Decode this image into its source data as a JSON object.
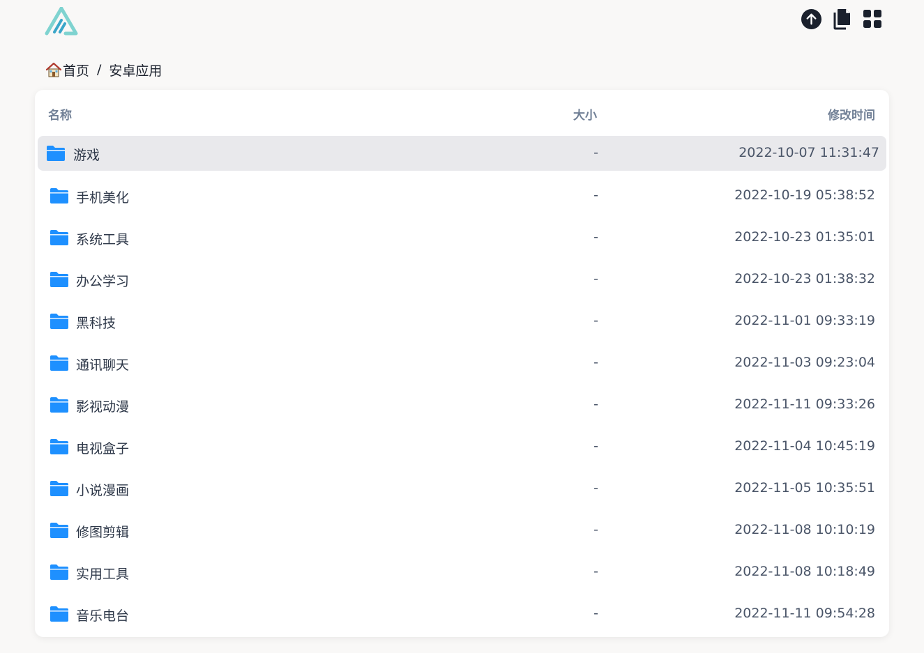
{
  "breadcrumb": {
    "home": "首页",
    "separator": "/",
    "current": "安卓应用"
  },
  "toolbar": {
    "icons": [
      "upload-icon",
      "copy-icon",
      "grid-icon"
    ]
  },
  "table": {
    "headers": {
      "name": "名称",
      "size": "大小",
      "time": "修改时间"
    },
    "rows": [
      {
        "name": "游戏",
        "size": "-",
        "time": "2022-10-07 11:31:47"
      },
      {
        "name": "手机美化",
        "size": "-",
        "time": "2022-10-19 05:38:52"
      },
      {
        "name": "系统工具",
        "size": "-",
        "time": "2022-10-23 01:35:01"
      },
      {
        "name": "办公学习",
        "size": "-",
        "time": "2022-10-23 01:38:32"
      },
      {
        "name": "黑科技",
        "size": "-",
        "time": "2022-11-01 09:33:19"
      },
      {
        "name": "通讯聊天",
        "size": "-",
        "time": "2022-11-03 09:23:04"
      },
      {
        "name": "影视动漫",
        "size": "-",
        "time": "2022-11-11 09:33:26"
      },
      {
        "name": "电视盒子",
        "size": "-",
        "time": "2022-11-04 10:45:19"
      },
      {
        "name": "小说漫画",
        "size": "-",
        "time": "2022-11-05 10:35:51"
      },
      {
        "name": "修图剪辑",
        "size": "-",
        "time": "2022-11-08 10:10:19"
      },
      {
        "name": "实用工具",
        "size": "-",
        "time": "2022-11-08 10:18:49"
      },
      {
        "name": "音乐电台",
        "size": "-",
        "time": "2022-11-11 09:54:28"
      }
    ]
  },
  "colors": {
    "folder": "#1e90ff",
    "logo_light": "#7fd3d0",
    "logo_dark": "#3aa6c9",
    "hover_row": "#e9e9ec",
    "header_text": "#718096"
  }
}
